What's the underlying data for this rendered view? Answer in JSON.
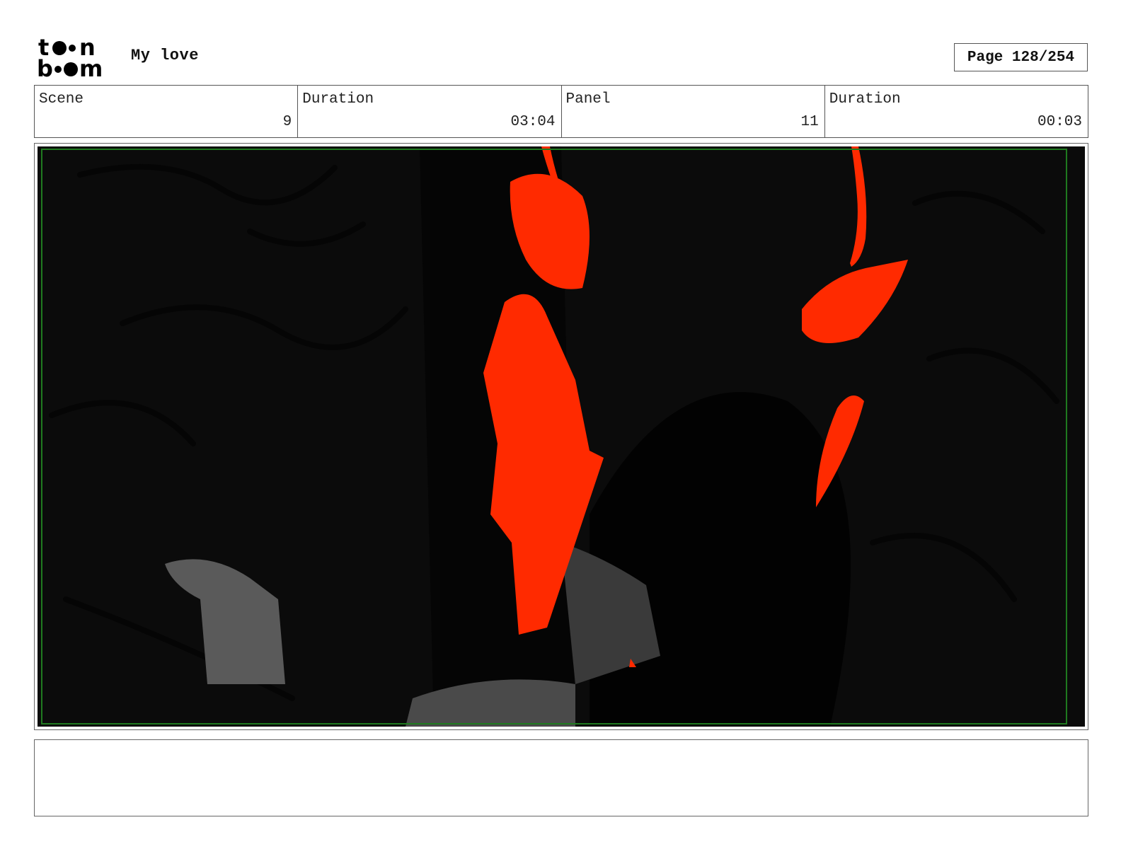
{
  "header": {
    "logo_text": "toon boom",
    "project_title": "My love",
    "page_label": "Page 128/254"
  },
  "info": {
    "scene_label": "Scene",
    "scene_value": "9",
    "scene_duration_label": "Duration",
    "scene_duration_value": "03:04",
    "panel_label": "Panel",
    "panel_value": "11",
    "panel_duration_label": "Duration",
    "panel_duration_value": "00:03"
  },
  "panel": {
    "colors": {
      "background": "#0b0b0b",
      "accent_red": "#ff2a00",
      "safe_frame": "#1f7a1f",
      "gray": "#555555"
    }
  },
  "notes": {
    "text": ""
  }
}
